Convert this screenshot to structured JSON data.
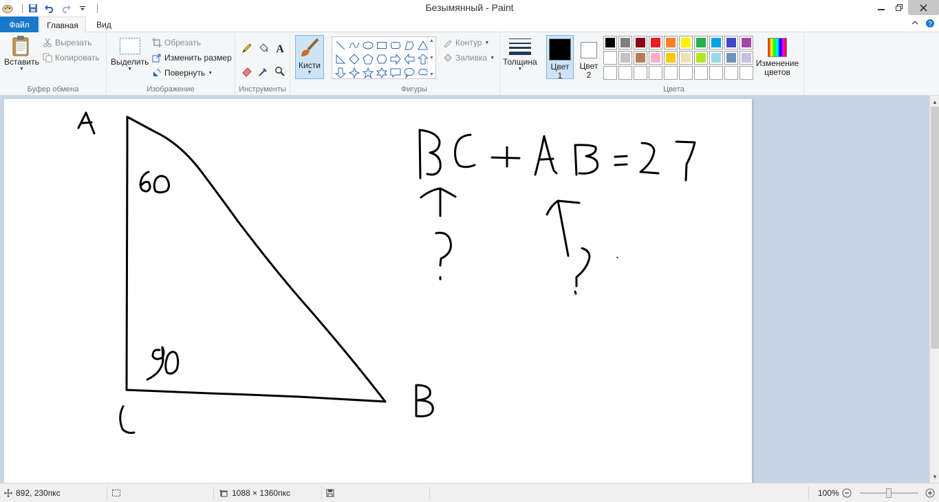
{
  "window": {
    "title": "Безымянный - Paint"
  },
  "tabs": {
    "file": "Файл",
    "home": "Главная",
    "view": "Вид"
  },
  "ribbon": {
    "clipboard": {
      "paste": "Вставить",
      "cut": "Вырезать",
      "copy": "Копировать",
      "label": "Буфер обмена"
    },
    "image": {
      "select": "Выделить",
      "crop": "Обрезать",
      "resize": "Изменить размер",
      "rotate": "Повернуть",
      "label": "Изображение"
    },
    "tools": {
      "label": "Инструменты"
    },
    "brushes": {
      "label": "Кисти"
    },
    "shapes": {
      "outline": "Контур",
      "fill": "Заливка",
      "label": "Фигуры"
    },
    "size": {
      "label": "Толщина"
    },
    "colors": {
      "color1_line1": "Цвет",
      "color1_line2": "1",
      "color2_line1": "Цвет",
      "color2_line2": "2",
      "edit_line1": "Изменение",
      "edit_line2": "цветов",
      "label": "Цвета",
      "color1": "#000000",
      "color2": "#ffffff",
      "palette_row1": [
        "#000000",
        "#7f7f7f",
        "#880015",
        "#ed1c24",
        "#ff7f27",
        "#fff200",
        "#22b14c",
        "#00a2e8",
        "#3f48cc",
        "#a349a4"
      ],
      "palette_row2": [
        "#ffffff",
        "#c3c3c3",
        "#b97a57",
        "#ffaec9",
        "#ffc90e",
        "#efe4b0",
        "#b5e61d",
        "#99d9ea",
        "#7092be",
        "#c8bfe7"
      ]
    }
  },
  "status": {
    "cursor_pos": "892, 230пкс",
    "canvas_size": "1088 × 1360пкс",
    "zoom": "100%"
  },
  "drawing": {
    "label_a": "A",
    "label_b": "B",
    "label_c": "C",
    "angle_60": "60",
    "angle_90": "90",
    "equation": "BC + AB = 27",
    "question_mark": "?"
  }
}
